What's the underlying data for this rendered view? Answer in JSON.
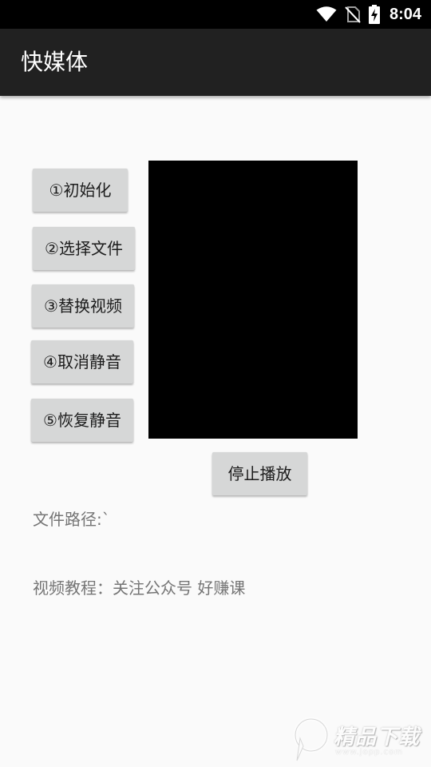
{
  "status_bar": {
    "time": "8:04",
    "icons": [
      "wifi-icon",
      "no-sim-icon",
      "battery-charging-icon"
    ]
  },
  "app_bar": {
    "title": "快媒体",
    "background": "#212121"
  },
  "buttons": {
    "init": "①初始化",
    "select_file": "②选择文件",
    "replace_video": "③替换视频",
    "unmute": "④取消静音",
    "mute": "⑤恢复静音",
    "stop": "停止播放"
  },
  "video_view": {
    "color": "#000000"
  },
  "info": {
    "file_path": "文件路径:`",
    "tutorial": "视频教程：关注公众号 好赚课"
  },
  "watermark": {
    "logo_text": "精品下载",
    "url": "www.jopp.com"
  }
}
